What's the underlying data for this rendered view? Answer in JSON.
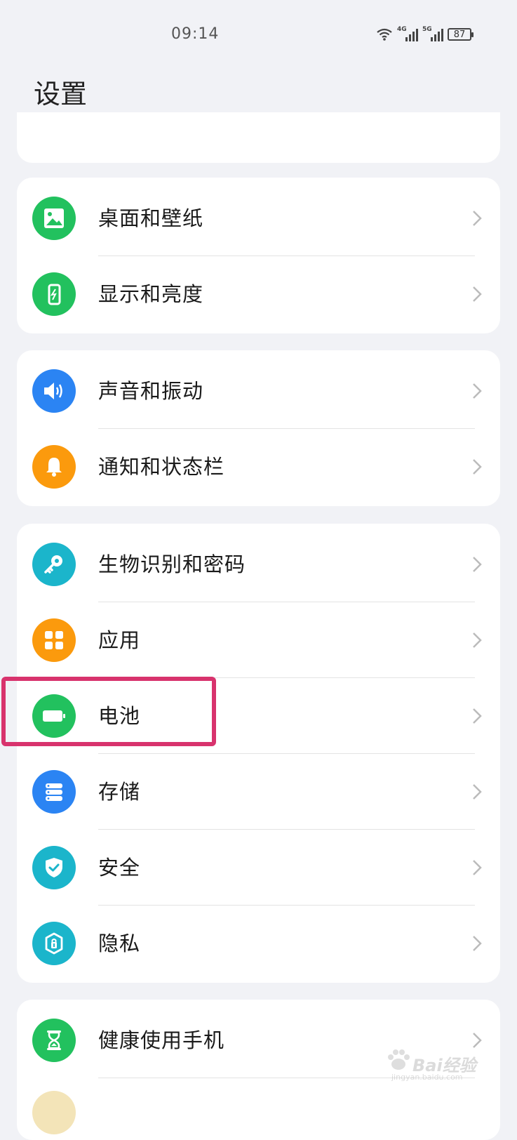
{
  "status_bar": {
    "time": "09:14",
    "network_1": "4G",
    "network_2": "5G",
    "battery_level": "87"
  },
  "page": {
    "title": "设置"
  },
  "groups": [
    {
      "items": [
        {
          "label": "桌面和壁纸",
          "icon": "wallpaper-icon",
          "color": "#22c15e"
        },
        {
          "label": "显示和亮度",
          "icon": "display-icon",
          "color": "#22c15e"
        }
      ]
    },
    {
      "items": [
        {
          "label": "声音和振动",
          "icon": "speaker-icon",
          "color": "#2b84f3"
        },
        {
          "label": "通知和状态栏",
          "icon": "bell-icon",
          "color": "#fb9a0d"
        }
      ]
    },
    {
      "items": [
        {
          "label": "生物识别和密码",
          "icon": "key-icon",
          "color": "#1bb5cb"
        },
        {
          "label": "应用",
          "icon": "apps-grid-icon",
          "color": "#fb9a0d"
        },
        {
          "label": "电池",
          "icon": "battery-icon",
          "color": "#22c15e"
        },
        {
          "label": "存储",
          "icon": "storage-icon",
          "color": "#2b84f3"
        },
        {
          "label": "安全",
          "icon": "shield-icon",
          "color": "#1bb5cb"
        },
        {
          "label": "隐私",
          "icon": "privacy-lock-icon",
          "color": "#1bb5cb"
        }
      ]
    },
    {
      "items": [
        {
          "label": "健康使用手机",
          "icon": "hourglass-icon",
          "color": "#22c15e"
        }
      ]
    }
  ],
  "highlight_color": "#d8336d",
  "watermark": {
    "text": "Bai经验",
    "url": "jingyan.baidu.com"
  }
}
